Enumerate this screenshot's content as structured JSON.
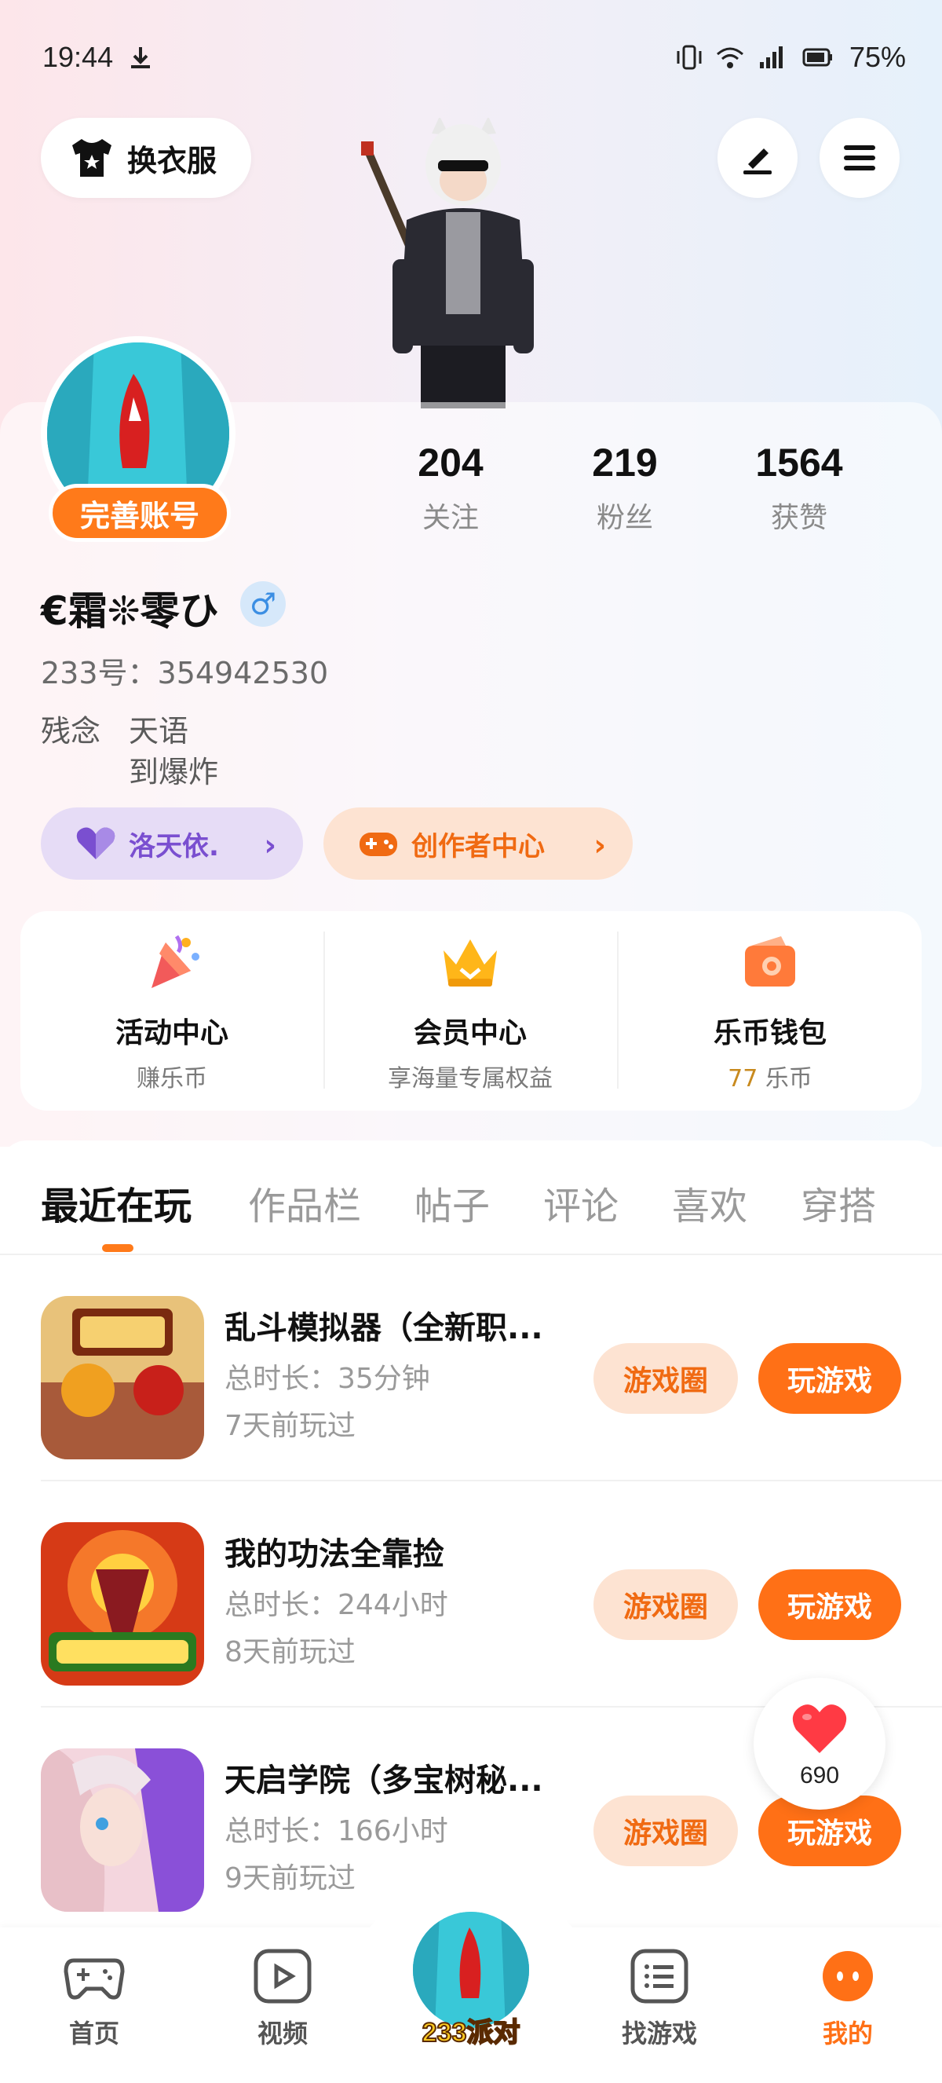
{
  "status_bar": {
    "time": "19:44",
    "battery": "75%"
  },
  "header": {
    "outfit_button": "换衣服"
  },
  "profile": {
    "complete_badge": "完善账号",
    "username": "€霜❊零ひ",
    "gender_symbol": "♂",
    "uid": "233号：354942530",
    "bio": [
      "残念",
      "天语",
      "到爆炸"
    ],
    "stats": [
      {
        "value": "204",
        "label": "关注"
      },
      {
        "value": "219",
        "label": "粉丝"
      },
      {
        "value": "1564",
        "label": "获赞"
      }
    ],
    "chips": [
      {
        "label": "洛天依.",
        "icon": "heart-icon"
      },
      {
        "label": "创作者中心",
        "icon": "gamepad-icon"
      }
    ]
  },
  "features": [
    {
      "title": "活动中心",
      "sub": "赚乐币"
    },
    {
      "title": "会员中心",
      "sub": "享海量专属权益"
    },
    {
      "title": "乐币钱包",
      "sub_coin": "77",
      "sub": "乐币"
    }
  ],
  "tabs": [
    "最近在玩",
    "作品栏",
    "帖子",
    "评论",
    "喜欢",
    "穿搭"
  ],
  "games": [
    {
      "name": "乱斗模拟器（全新职...",
      "duration": "总时长：35分钟",
      "last_played": "7天前玩过",
      "circle_btn": "游戏圈",
      "play_btn": "玩游戏"
    },
    {
      "name": "我的功法全靠捡",
      "duration": "总时长：244小时",
      "last_played": "8天前玩过",
      "circle_btn": "游戏圈",
      "play_btn": "玩游戏"
    },
    {
      "name": "天启学院（多宝树秘...",
      "duration": "总时长：166小时",
      "last_played": "9天前玩过",
      "circle_btn": "游戏圈",
      "play_btn": "玩游戏"
    }
  ],
  "like_float": {
    "count": "690"
  },
  "bottom_nav": [
    {
      "label": "首页",
      "icon": "gamepad-icon"
    },
    {
      "label": "视频",
      "icon": "play-icon"
    },
    {
      "label": "233派对",
      "icon": "party-avatar"
    },
    {
      "label": "找游戏",
      "icon": "list-icon"
    },
    {
      "label": "我的",
      "icon": "face-icon"
    }
  ],
  "colors": {
    "accent": "#ff7016",
    "accent_light": "#fde3d2",
    "purple_chip": "#e6dcf6"
  }
}
